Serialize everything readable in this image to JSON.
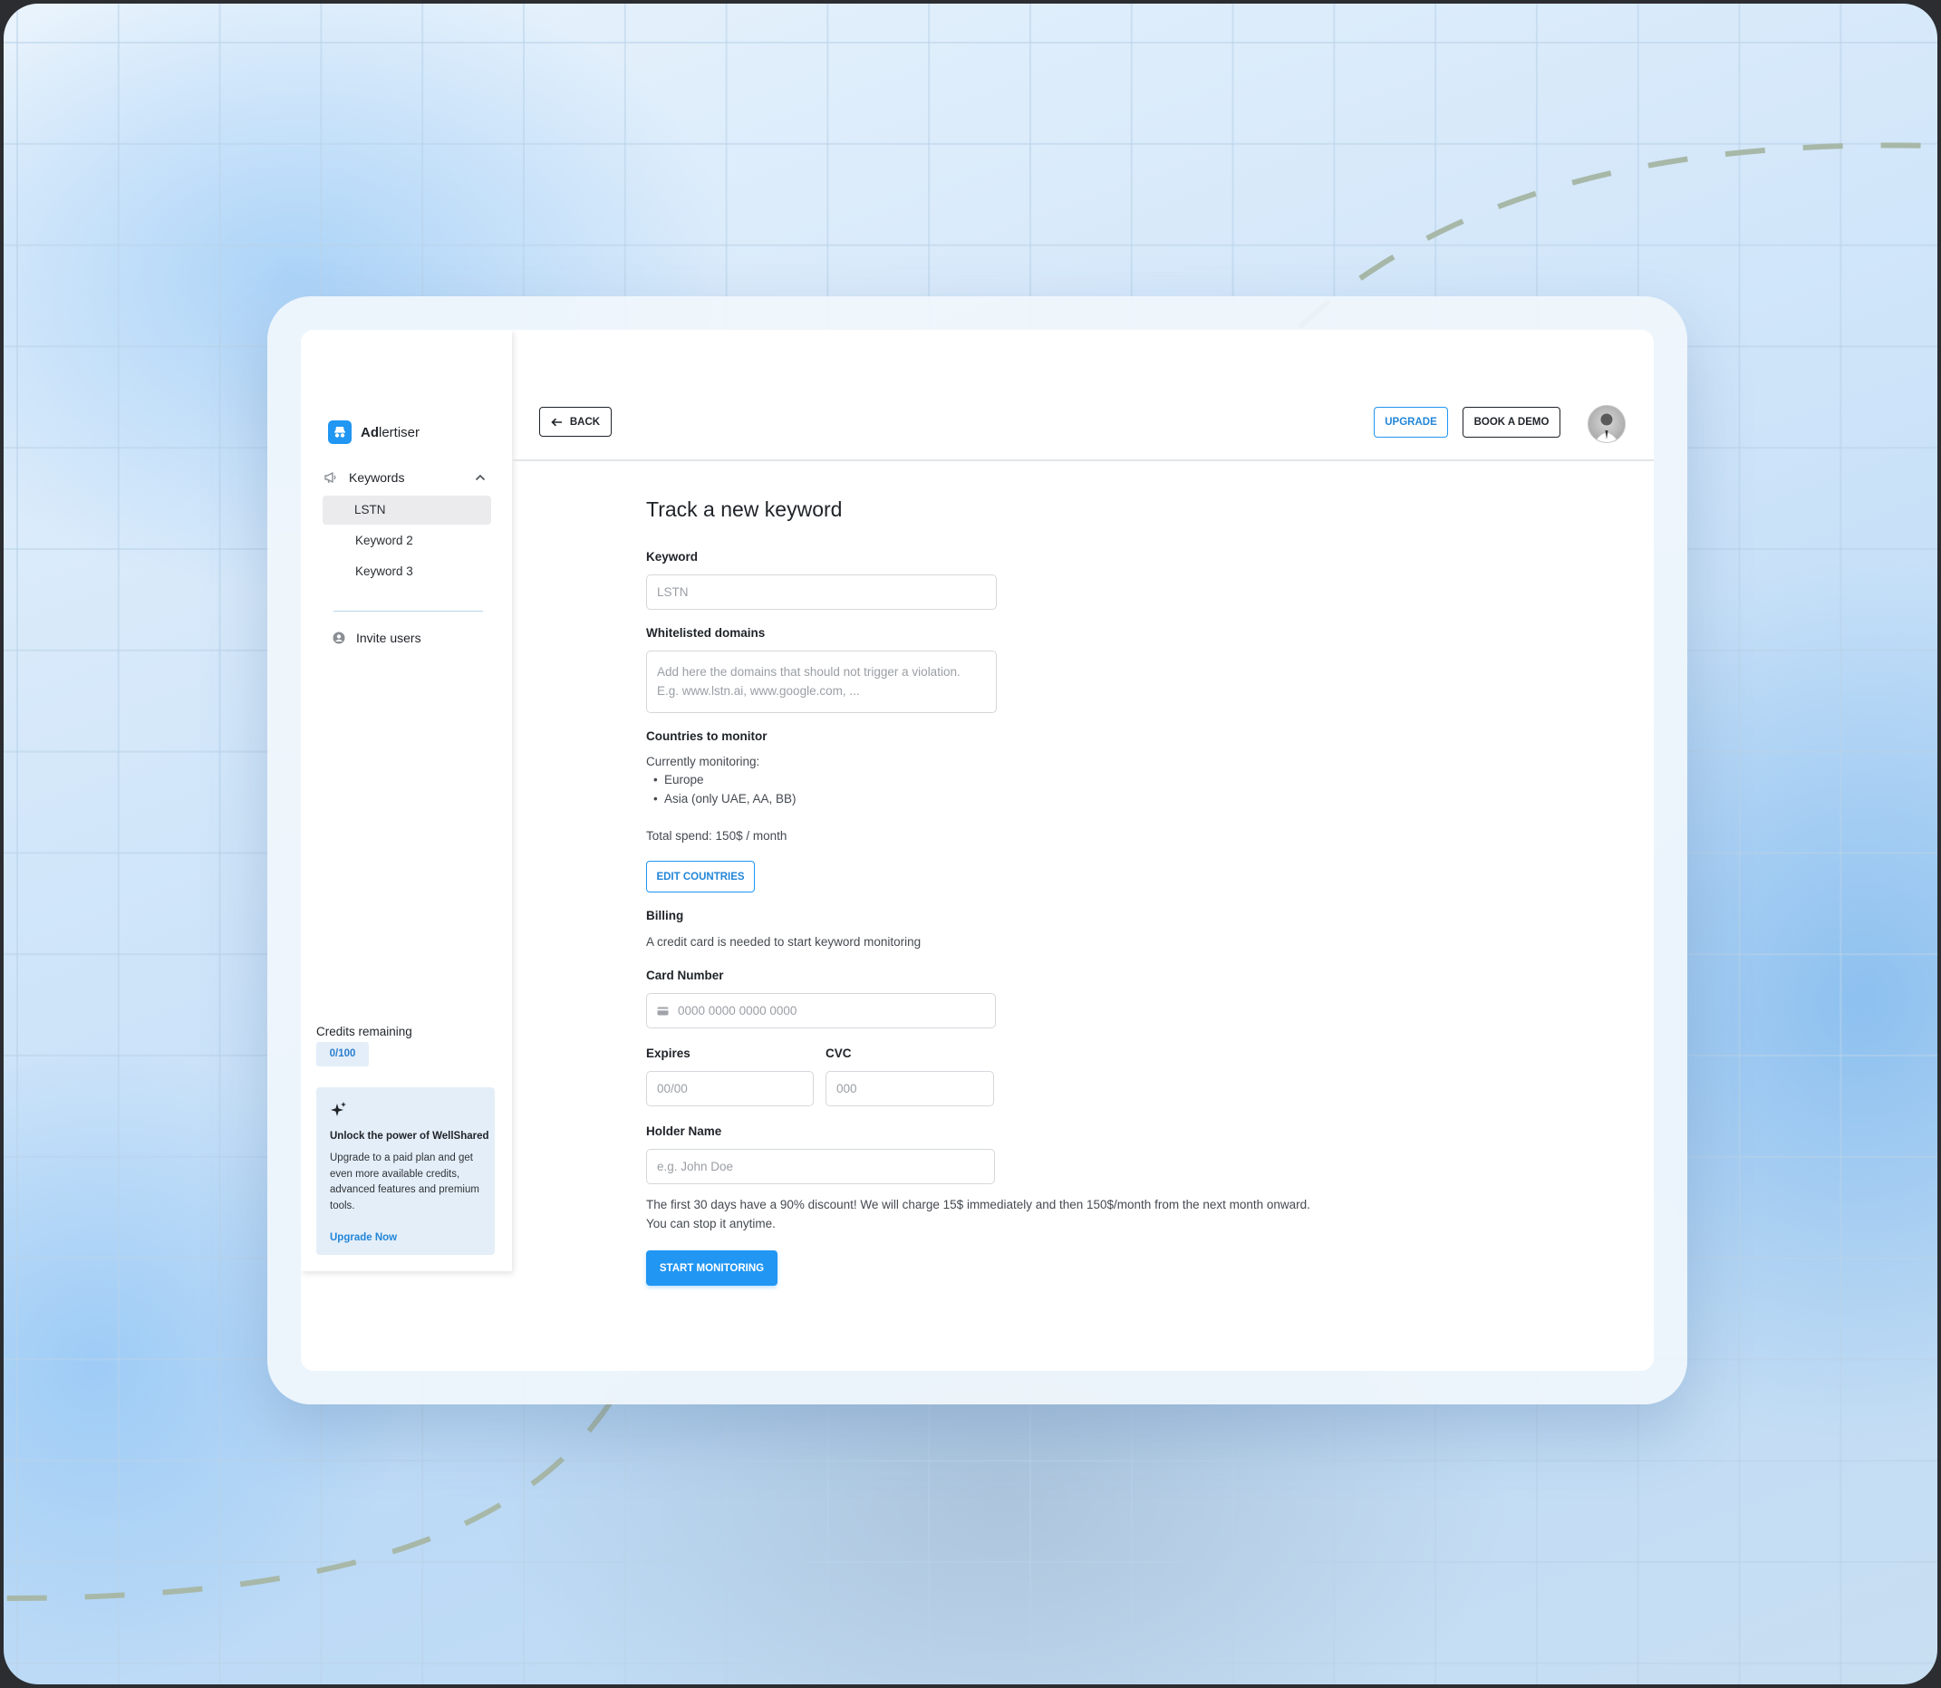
{
  "colors": {
    "accent": "#2196f3",
    "text": "#1f2328",
    "border": "#d4d7db",
    "badge_bg": "#e3eef9"
  },
  "sidebar": {
    "logo": {
      "icon": "spy-icon",
      "bold": "Ad",
      "rest": "lertiser"
    },
    "keywords_header": "Keywords",
    "keywords_icon": "megaphone-icon",
    "items": [
      {
        "label": "LSTN",
        "active": true
      },
      {
        "label": "Keyword 2",
        "active": false
      },
      {
        "label": "Keyword 3",
        "active": false
      }
    ],
    "invite_label": "Invite users",
    "invite_icon": "user-circle-icon",
    "credits_label": "Credits remaining",
    "credits_value": "0/100",
    "promo": {
      "icon": "sparkle-icon",
      "title": "Unlock the power of WellShared",
      "text": "Upgrade to a paid plan and get even more available credits, advanced features and premium tools.",
      "link": "Upgrade Now"
    }
  },
  "header": {
    "back_label": "BACK",
    "upgrade_label": "UPGRADE",
    "demo_label": "BOOK A DEMO"
  },
  "form": {
    "title": "Track a new keyword",
    "keyword": {
      "label": "Keyword",
      "placeholder": "LSTN"
    },
    "domains": {
      "label": "Whitelisted domains",
      "placeholder_line1": "Add here the domains that should not trigger a violation.",
      "placeholder_line2": "E.g. www.lstn.ai, www.google.com, ..."
    },
    "countries": {
      "label": "Countries to monitor",
      "monitoring_text": "Currently monitoring:",
      "regions": [
        "Europe",
        "Asia (only UAE, AA, BB)"
      ],
      "total_spend": "Total spend: 150$ / month",
      "edit_label": "EDIT COUNTRIES"
    },
    "billing": {
      "label": "Billing",
      "text": "A credit card is needed to start keyword monitoring",
      "card_label": "Card Number",
      "card_placeholder": "0000 0000 0000 0000",
      "card_icon": "credit-card-icon",
      "expires_label": "Expires",
      "expires_placeholder": "00/00",
      "cvc_label": "CVC",
      "cvc_placeholder": "000",
      "holder_label": "Holder Name",
      "holder_placeholder": "e.g. John Doe",
      "notice_line1": "The first 30 days have a 90% discount! We will charge 15$ immediately and then 150$/month from the next month onward.",
      "notice_line2": "You can stop it anytime."
    },
    "start_label": "START MONITORING"
  }
}
